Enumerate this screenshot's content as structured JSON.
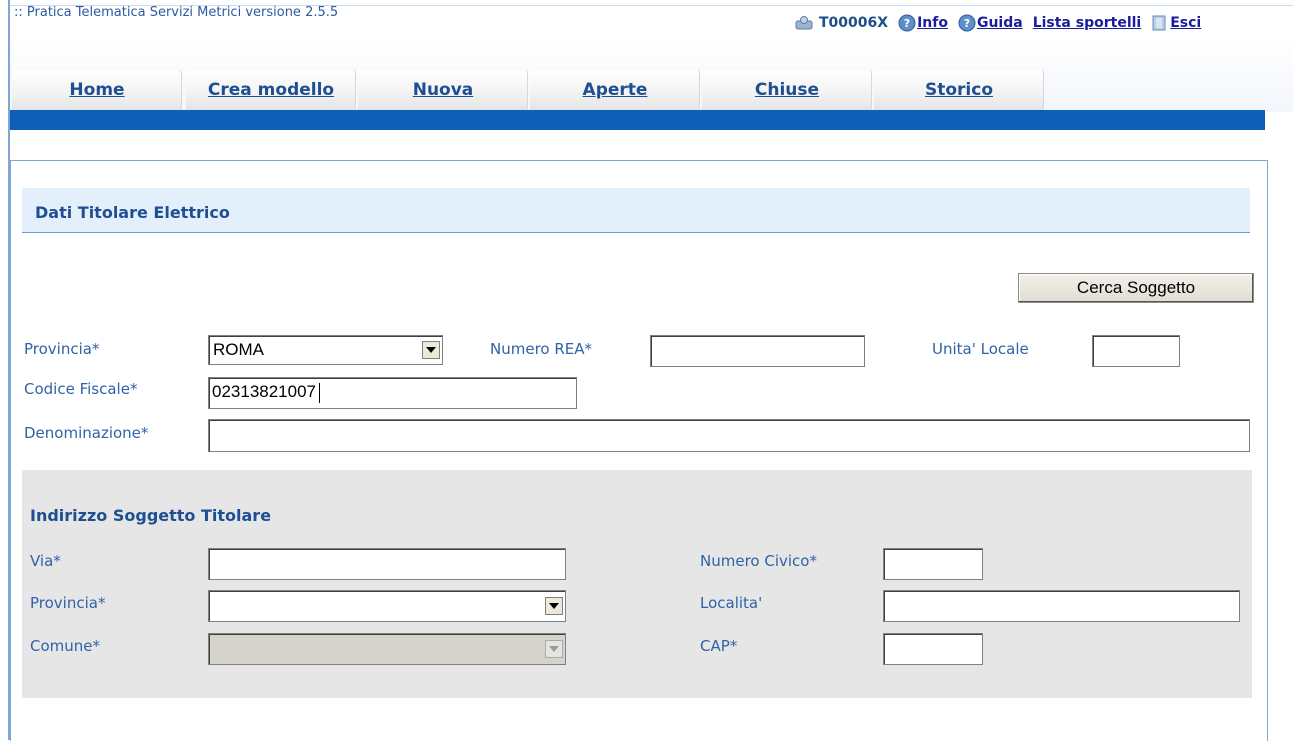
{
  "header": {
    "app_title": ":: Pratica Telematica Servizi Metrici versione 2.5.5",
    "user_code": "T00006X",
    "links": {
      "info": "Info",
      "guida": "Guida",
      "lista_sportelli": "Lista sportelli",
      "esci": "Esci"
    }
  },
  "tabs": [
    "Home",
    "Crea modello",
    "Nuova",
    "Aperte",
    "Chiuse",
    "Storico"
  ],
  "section": {
    "title": "Dati Titolare Elettrico",
    "search_button": "Cerca Soggetto"
  },
  "form": {
    "provincia_label": "Provincia*",
    "provincia_value": "ROMA",
    "numero_rea_label": "Numero REA*",
    "numero_rea_value": "",
    "unita_locale_label": "Unita' Locale",
    "unita_locale_value": "",
    "codice_fiscale_label": "Codice Fiscale*",
    "codice_fiscale_value": "02313821007",
    "denominazione_label": "Denominazione*",
    "denominazione_value": ""
  },
  "address": {
    "title": "Indirizzo Soggetto Titolare",
    "via_label": "Via*",
    "via_value": "",
    "numero_civico_label": "Numero Civico*",
    "numero_civico_value": "",
    "provincia_label": "Provincia*",
    "provincia_value": "",
    "localita_label": "Localita'",
    "localita_value": "",
    "comune_label": "Comune*",
    "comune_value": "",
    "cap_label": "CAP*",
    "cap_value": ""
  },
  "colors": {
    "accent_blue": "#0e60b6",
    "label_blue": "#2f62a8",
    "section_bg": "#e3f0fb",
    "panel_gray": "#e6e6e6"
  }
}
